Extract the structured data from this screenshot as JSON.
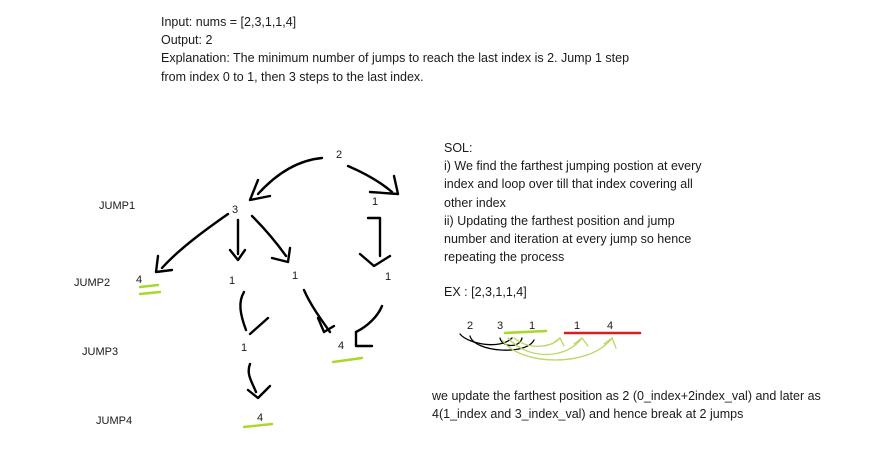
{
  "problem": {
    "input": "Input: nums = [2,3,1,1,4]",
    "output": "Output: 2",
    "explanation_line1": "Explanation: The minimum number of jumps to reach the last index is 2. Jump 1 step",
    "explanation_line2": "from index 0 to 1, then 3 steps to the last index."
  },
  "tree": {
    "jump_labels": [
      "JUMP1",
      "JUMP2",
      "JUMP3",
      "JUMP4"
    ],
    "nodes": {
      "root": "2",
      "n3": "3",
      "n1_right": "1",
      "n4_left": "4",
      "n1_mid_a": "1",
      "n1_mid_b": "1",
      "n1_right_b": "1",
      "n1_j3": "1",
      "n4_j3": "4",
      "n4_j4": "4"
    }
  },
  "solution": {
    "heading": "SOL:",
    "lines": [
      "i) We find the farthest jumping postion at every",
      "index and loop over till that index covering all",
      "other index",
      "ii) Updating the farthest position and jump",
      "number and iteration at every jump so hence",
      "repeating the process"
    ],
    "example": "EX : [2,3,1,1,4]",
    "array_values": [
      "2",
      "3",
      "1",
      "1",
      "4"
    ],
    "conclusion_line1": "we update the farthest position as 2 (0_index+2index_val) and later as",
    "conclusion_line2": "4(1_index and 3_index_val) and hence break at 2 jumps"
  },
  "colors": {
    "ink": "#000000",
    "highlight_green": "#a8d82a",
    "highlight_red": "#d81e1e",
    "arc_green": "#b8d860"
  }
}
